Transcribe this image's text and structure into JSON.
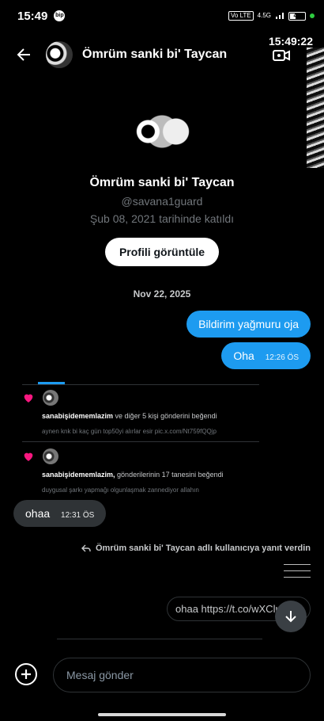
{
  "status_bar": {
    "time": "15:49",
    "app_icon_text": "bip",
    "volte": "Vo LTE",
    "network": "4.5G",
    "battery_level": "44",
    "battery_fill": 0.44
  },
  "overlay_clock": "15:49:22",
  "header": {
    "title": "Ömrüm sanki bi' Taycan"
  },
  "profile": {
    "name": "Ömrüm sanki bi' Taycan",
    "handle": "@savana1guard",
    "joined": "Şub 08, 2021 tarihinde katıldı",
    "view_button": "Profili görüntüle"
  },
  "date_separator": "Nov 22, 2025",
  "messages_out": [
    {
      "text": "Bildirim yağmuru oja",
      "time": ""
    },
    {
      "text": "Oha",
      "time": "12:26 ÖS"
    }
  ],
  "notifications": [
    {
      "user": "sanabişidememlazim",
      "action": " ve diğer 5 kişi gönderini beğendi",
      "preview": "aynen knk bi kaç gün top50yi alırlar esir pic.x.com/Nt759fQQjp"
    },
    {
      "user": "sanabişidememlazim,",
      "action": " gönderilerinin 17 tanesini beğendi",
      "preview": "duygusal şarkı yapmağı olgunlaşmak zannediyor allahın"
    }
  ],
  "message_in": {
    "text": "ohaa",
    "time": "12:31 ÖS"
  },
  "reply_note": "Ömrüm sanki bi' Taycan adlı kullanıcıya yanıt verdin",
  "link_message": "ohaa https://t.co/wXClu",
  "composer": {
    "placeholder": "Mesaj gönder"
  },
  "colors": {
    "accent": "#1d9bf0",
    "heart": "#f91880",
    "background": "#000000",
    "incoming_bubble": "#2f3336"
  }
}
